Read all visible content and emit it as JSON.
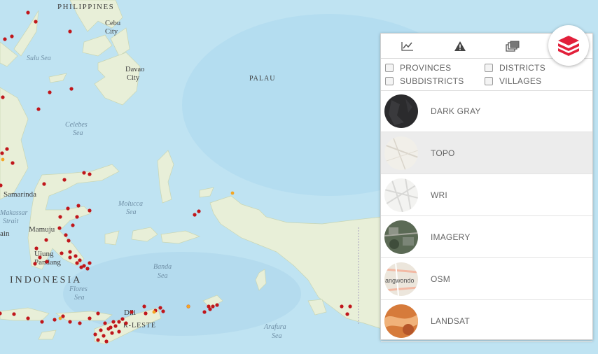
{
  "map": {
    "labels": {
      "philippines": "PHILIPPINES",
      "cebu": "Cebu",
      "cebu_city": "City",
      "davao": "Davao",
      "davao_city": "City",
      "palau": "PALAU",
      "sulu_sea": "Sulu Sea",
      "celebes_sea_1": "Celebes",
      "celebes_sea_2": "Sea",
      "molucca_sea_1": "Molucca",
      "molucca_sea_2": "Sea",
      "banda_sea_1": "Banda",
      "banda_sea_2": "Sea",
      "flores_sea_1": "Flores",
      "flores_sea_2": "Sea",
      "arafura_sea_1": "Arafura",
      "arafura_sea_2": "Sea",
      "makassar_1": "Makassar",
      "makassar_2": "Strait",
      "samarinda": "Samarinda",
      "mamuju": "Mamuju",
      "ujung": "Ujung",
      "pandang": "Pandang",
      "indonesia": "INDONESIA",
      "dili": "Dili",
      "timor_leste": "R-LESTE",
      "ain": "ain"
    },
    "colors": {
      "water": "#bfe3f2",
      "land": "#e8efd8",
      "point": "#c0161b",
      "point_alt": "#f5a623"
    }
  },
  "panel": {
    "tabs": [
      {
        "icon": "line-chart-icon"
      },
      {
        "icon": "warning-icon"
      },
      {
        "icon": "layers-stack-icon"
      },
      {
        "icon": "basemap-icon"
      }
    ],
    "checkboxes": {
      "provinces": "PROVINCES",
      "districts": "DISTRICTS",
      "subdistricts": "SUBDISTRICTS",
      "villages": "VILLAGES"
    },
    "basemaps": [
      {
        "label": "DARK GRAY",
        "selected": false
      },
      {
        "label": "TOPO",
        "selected": true
      },
      {
        "label": "WRI",
        "selected": false
      },
      {
        "label": "IMAGERY",
        "selected": false
      },
      {
        "label": "OSM",
        "selected": false
      },
      {
        "label": "LANDSAT",
        "selected": false
      }
    ],
    "osm_thumb_text": "angwondo",
    "accent_color": "#e2203b"
  }
}
